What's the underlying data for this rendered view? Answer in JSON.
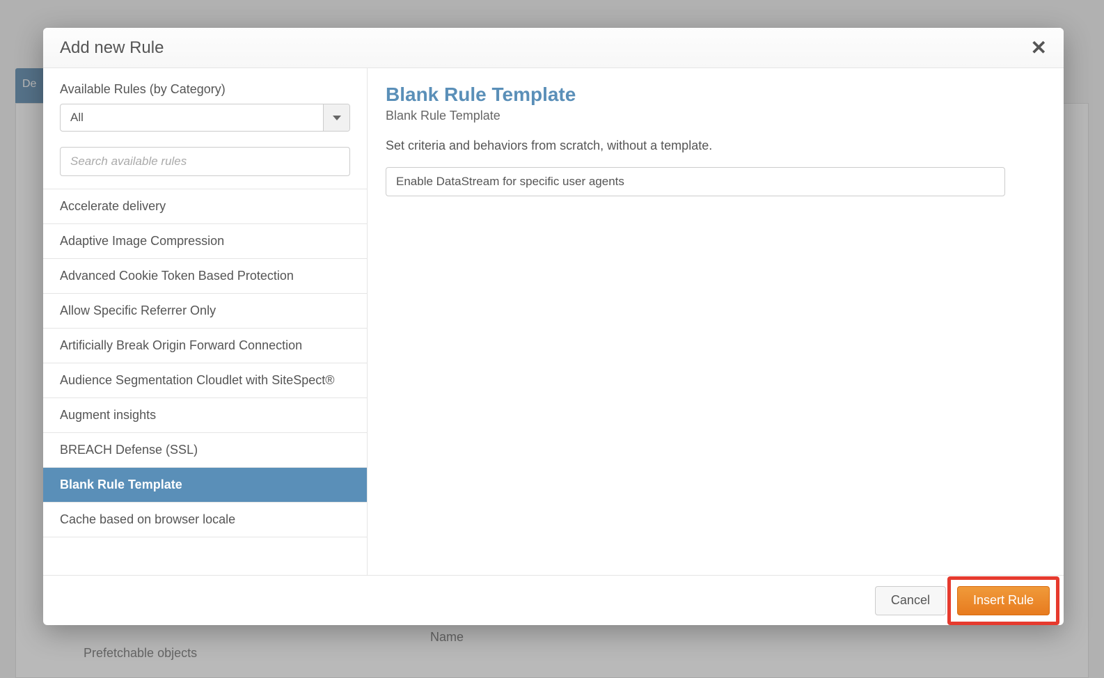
{
  "background": {
    "page_title_fragment": "",
    "tab_fragment": "De",
    "side_label": "Prefetchable objects",
    "mid_label": "Name"
  },
  "modal": {
    "title": "Add new Rule",
    "filter_label": "Available Rules (by Category)",
    "category_value": "All",
    "search_placeholder": "Search available rules",
    "rules": [
      {
        "label": "Accelerate delivery",
        "selected": false
      },
      {
        "label": "Adaptive Image Compression",
        "selected": false
      },
      {
        "label": "Advanced Cookie Token Based Protection",
        "selected": false
      },
      {
        "label": "Allow Specific Referrer Only",
        "selected": false
      },
      {
        "label": "Artificially Break Origin Forward Connection",
        "selected": false
      },
      {
        "label": "Audience Segmentation Cloudlet with SiteSpect®",
        "selected": false
      },
      {
        "label": "Augment insights",
        "selected": false
      },
      {
        "label": "BREACH Defense (SSL)",
        "selected": false
      },
      {
        "label": "Blank Rule Template",
        "selected": true
      },
      {
        "label": "Cache based on browser locale",
        "selected": false
      }
    ],
    "template": {
      "title": "Blank Rule Template",
      "subtitle": "Blank Rule Template",
      "description": "Set criteria and behaviors from scratch, without a template.",
      "name_value": "Enable DataStream for specific user agents"
    },
    "footer": {
      "cancel": "Cancel",
      "insert": "Insert Rule"
    }
  }
}
